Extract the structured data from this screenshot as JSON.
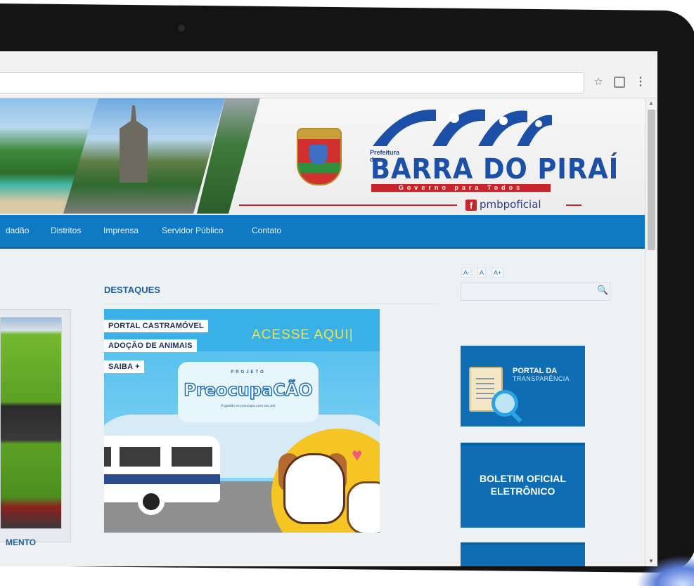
{
  "browser": {
    "star_icon": "star-icon",
    "extension_icon": "extension-icon",
    "menu_icon": "kebab-menu-icon"
  },
  "header": {
    "logo_prefix": "Prefeitura de",
    "logo_title": "BARRA DO PIRAÍ",
    "logo_motto": "Governo para Todos",
    "social_handle": "pmbpoficial",
    "social_icon": "facebook-icon"
  },
  "nav": {
    "items": [
      "dadão",
      "Distritos",
      "Imprensa",
      "Servidor Público",
      "Contato"
    ]
  },
  "main": {
    "section_title": "DESTAQUES",
    "left_caption": "MENTO",
    "feature": {
      "tags": [
        "PORTAL CASTRAMÓVEL",
        "ADOÇÃO DE ANIMAIS",
        "SAIBA +"
      ],
      "cta": "ACESSE AQUI|",
      "project_kicker": "PROJETO",
      "project_name": "PreocupaCÃO",
      "project_tagline": "A gestão se preocupa com seu pet"
    }
  },
  "sidebar": {
    "font_buttons": [
      "A-",
      "A",
      "A+"
    ],
    "search_placeholder": "",
    "tiles": {
      "transparencia_title": "PORTAL DA",
      "transparencia_sub": "TRANSPARÊNCIA",
      "boletim_title": "BOLETIM OFICIAL ELETRÔNICO"
    }
  },
  "colors": {
    "nav_blue": "#0f79c4",
    "brand_blue": "#1b4fa8",
    "brand_red": "#c8242b",
    "heading_blue": "#1f5e9a"
  }
}
